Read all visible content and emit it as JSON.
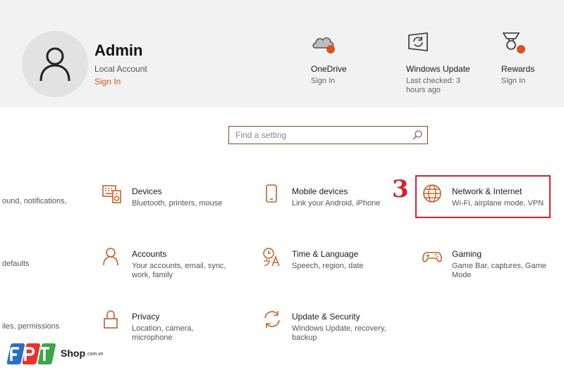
{
  "account": {
    "name": "Admin",
    "type": "Local Account",
    "sign_in": "Sign In"
  },
  "services": [
    {
      "title": "OneDrive",
      "sub": "Sign In",
      "icon": "cloud-icon"
    },
    {
      "title": "Windows Update",
      "sub": "Last checked: 3 hours ago",
      "icon": "refresh-icon"
    },
    {
      "title": "Rewards",
      "sub": "Sign In",
      "icon": "trophy-icon"
    }
  ],
  "search": {
    "placeholder": "Find a setting"
  },
  "tiles": {
    "devices": {
      "title": "Devices",
      "sub": "Bluetooth, printers, mouse"
    },
    "mobile": {
      "title": "Mobile devices",
      "sub": "Link your Android, iPhone"
    },
    "network": {
      "title": "Network & Internet",
      "sub": "Wi-Fi, airplane mode, VPN"
    },
    "accounts": {
      "title": "Accounts",
      "sub": "Your accounts, email, sync, work, family"
    },
    "time": {
      "title": "Time & Language",
      "sub": "Speech, region, date"
    },
    "gaming": {
      "title": "Gaming",
      "sub": "Game Bar, captures, Game Mode"
    },
    "privacy": {
      "title": "Privacy",
      "sub": "Location, camera, microphone"
    },
    "update": {
      "title": "Update & Security",
      "sub": "Windows Update, recovery, backup"
    }
  },
  "left_cut": [
    "ound, notifications,",
    "defaults",
    "iles, permissions"
  ],
  "step_number": "3",
  "logo": {
    "brand": "FPT",
    "shop": "Shop",
    "domain": ".com.vn"
  },
  "colors": {
    "accent": "#c75b1e",
    "highlight": "#d0252c",
    "header_bg": "#f2f2f2"
  }
}
